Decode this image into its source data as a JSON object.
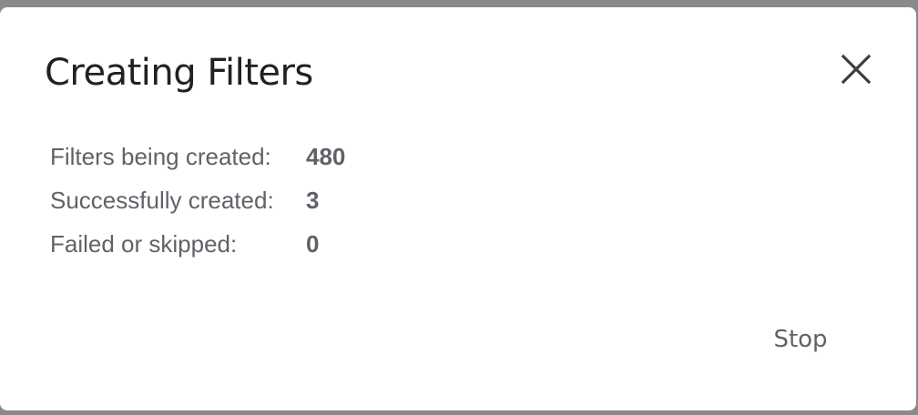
{
  "dialog": {
    "title": "Creating Filters",
    "close_icon": "close-icon",
    "stats": [
      {
        "label": "Filters being created:",
        "value": "480"
      },
      {
        "label": "Successfully created:",
        "value": "3"
      },
      {
        "label": "Failed or skipped:",
        "value": "0"
      }
    ],
    "stop_label": "Stop"
  },
  "colors": {
    "title": "#202124",
    "text": "#5f6368",
    "backdrop": "#8a8a8a",
    "surface": "#ffffff"
  }
}
